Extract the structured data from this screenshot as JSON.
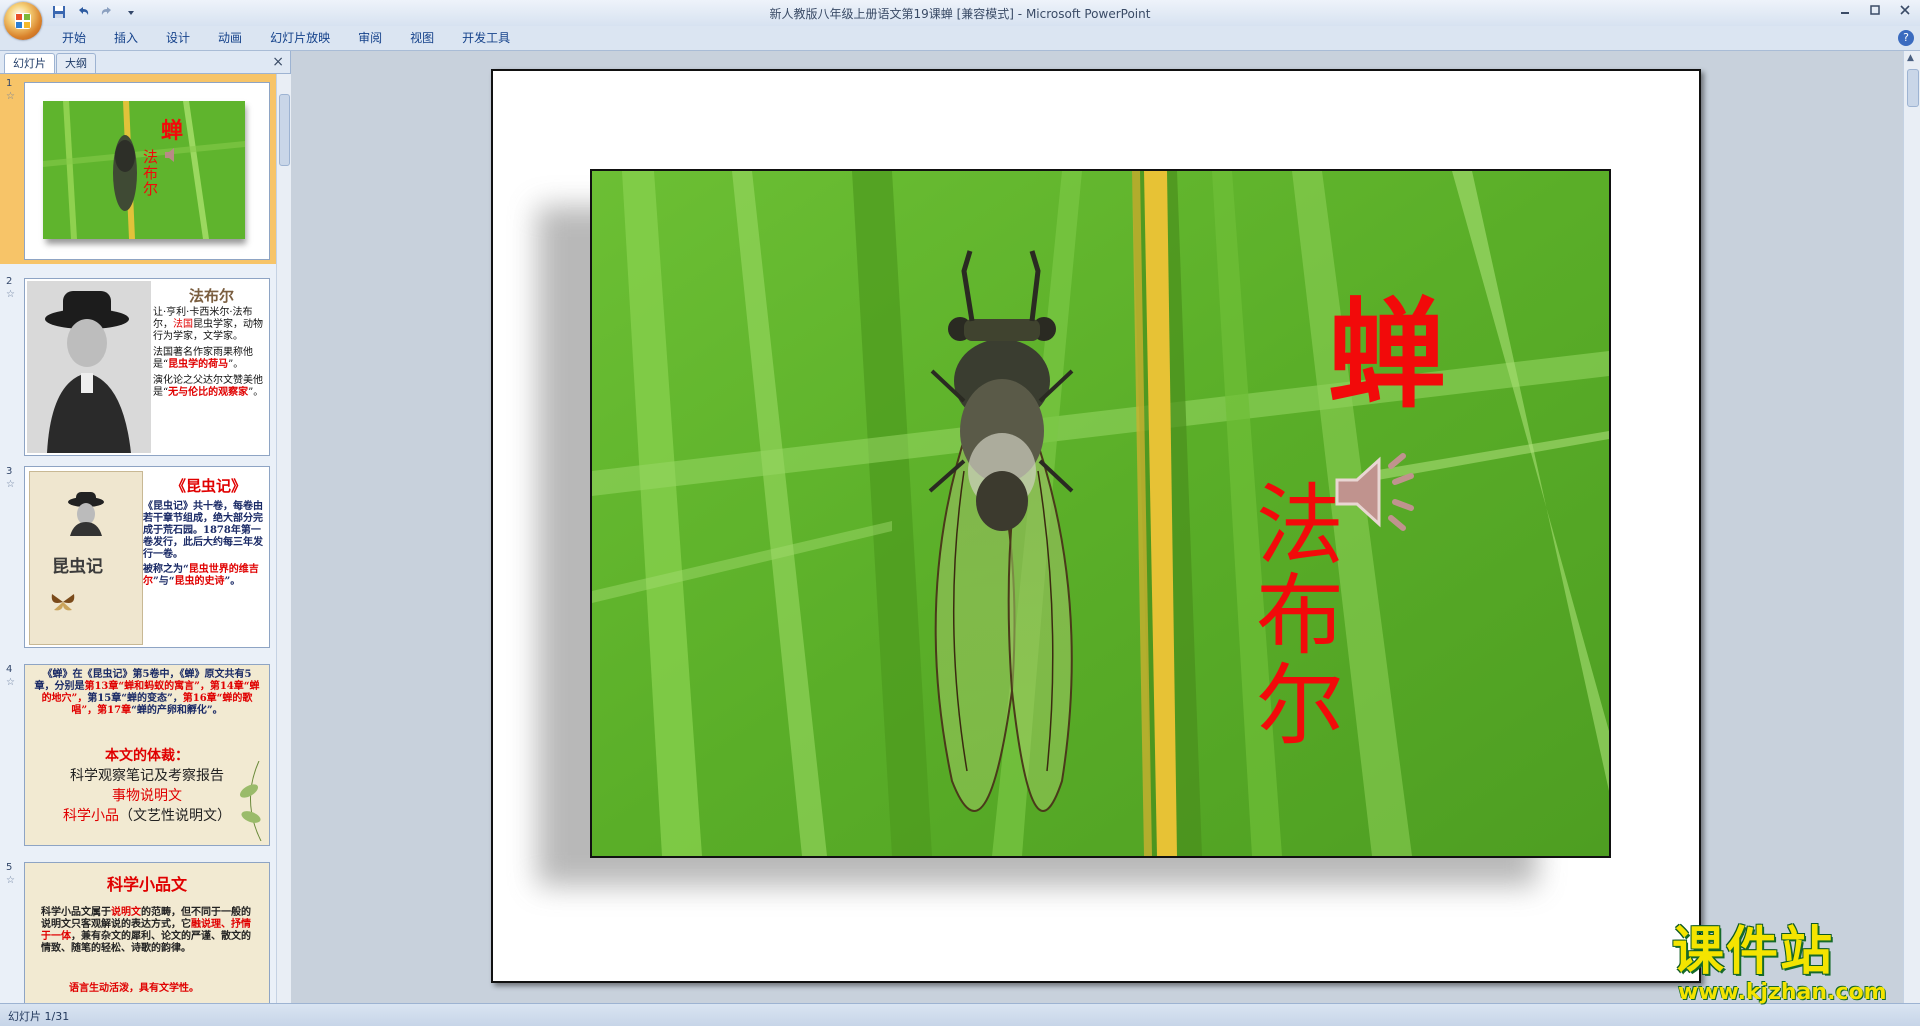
{
  "window": {
    "title": "新人教版八年级上册语文第19课蝉 [兼容模式] - Microsoft PowerPoint",
    "qat": [
      "save-icon",
      "undo-icon",
      "redo-icon",
      "customize-icon"
    ]
  },
  "ribbon": {
    "tabs": [
      "开始",
      "插入",
      "设计",
      "动画",
      "幻灯片放映",
      "审阅",
      "视图",
      "开发工具"
    ]
  },
  "panel": {
    "tab_slides": "幻灯片",
    "tab_outline": "大纲",
    "close": "×",
    "thumbs": [
      {
        "num": "1",
        "title": "蝉",
        "author": "法布尔"
      },
      {
        "num": "2",
        "title": "法布尔",
        "p1_a": "让·亨利·卡西米尔·法布尔，",
        "p1_hl": "法国",
        "p1_b": "昆虫学家，动物行为学家，文学家。",
        "p2_a": "法国著名作家雨果称他是“",
        "p2_hl": "昆虫学的荷马",
        "p2_b": "”。",
        "p3_a": "演化论之父达尔文赞美他是“",
        "p3_hl": "无与伦比的观察家",
        "p3_b": "”。"
      },
      {
        "num": "3",
        "title": "《昆虫记》",
        "cover": "昆虫记",
        "body": "《昆虫记》共十卷，每卷由若干章节组成，绝大部分完成于荒石园。1878年第一卷发行，此后大约每三年发行一卷。",
        "p2_a": "被称之为“",
        "p2_hl": "昆虫世界的维吉尔",
        "p2_b": "”与“",
        "p2_hl2": "昆虫的史诗",
        "p2_c": "”。"
      },
      {
        "num": "4",
        "l1_a": "《蝉》在《昆虫记》第5卷中，《蝉》原文共有5章，分别是",
        "l1_hl": "第13章“蝉和蚂蚁的寓言”，第14章“蝉的地穴”，",
        "l1_b": "第15章“蝉的变态”，",
        "l1_hl2": "第16章“蝉的歌唱”，第17章",
        "l1_c": "“蝉的产卵和孵化”。",
        "h1": "本文的体裁：",
        "h2": "科学观察笔记及考察报告",
        "h3": "事物说明文",
        "h4_a": "科学小品",
        "h4_b": "（文艺性说明文）"
      },
      {
        "num": "5",
        "title": "科学小品文",
        "b_a": "科学小品文属于",
        "b_hl": "说明文",
        "b_b": "的范畴，但不同于一般的说明文只客观解说的表达方式，它",
        "b_hl2": "融说理、抒情于一体",
        "b_c": "，兼有杂文的犀利、论文的严谨、散文的情致、随笔的轻松、诗歌的韵律。",
        "last": "语言生动活泼，具有文学性。"
      }
    ]
  },
  "slide": {
    "title": "蝉",
    "author": "法布尔",
    "audio_icon": "speaker-icon"
  },
  "status": {
    "text": "幻灯片 1/31"
  },
  "watermark": {
    "cn": "课件站",
    "url": "www.kjzhan.com"
  },
  "colors": {
    "accent_red": "#f20a0a",
    "grass_green": "#5fb52c",
    "ribbon_text": "#15428b"
  }
}
